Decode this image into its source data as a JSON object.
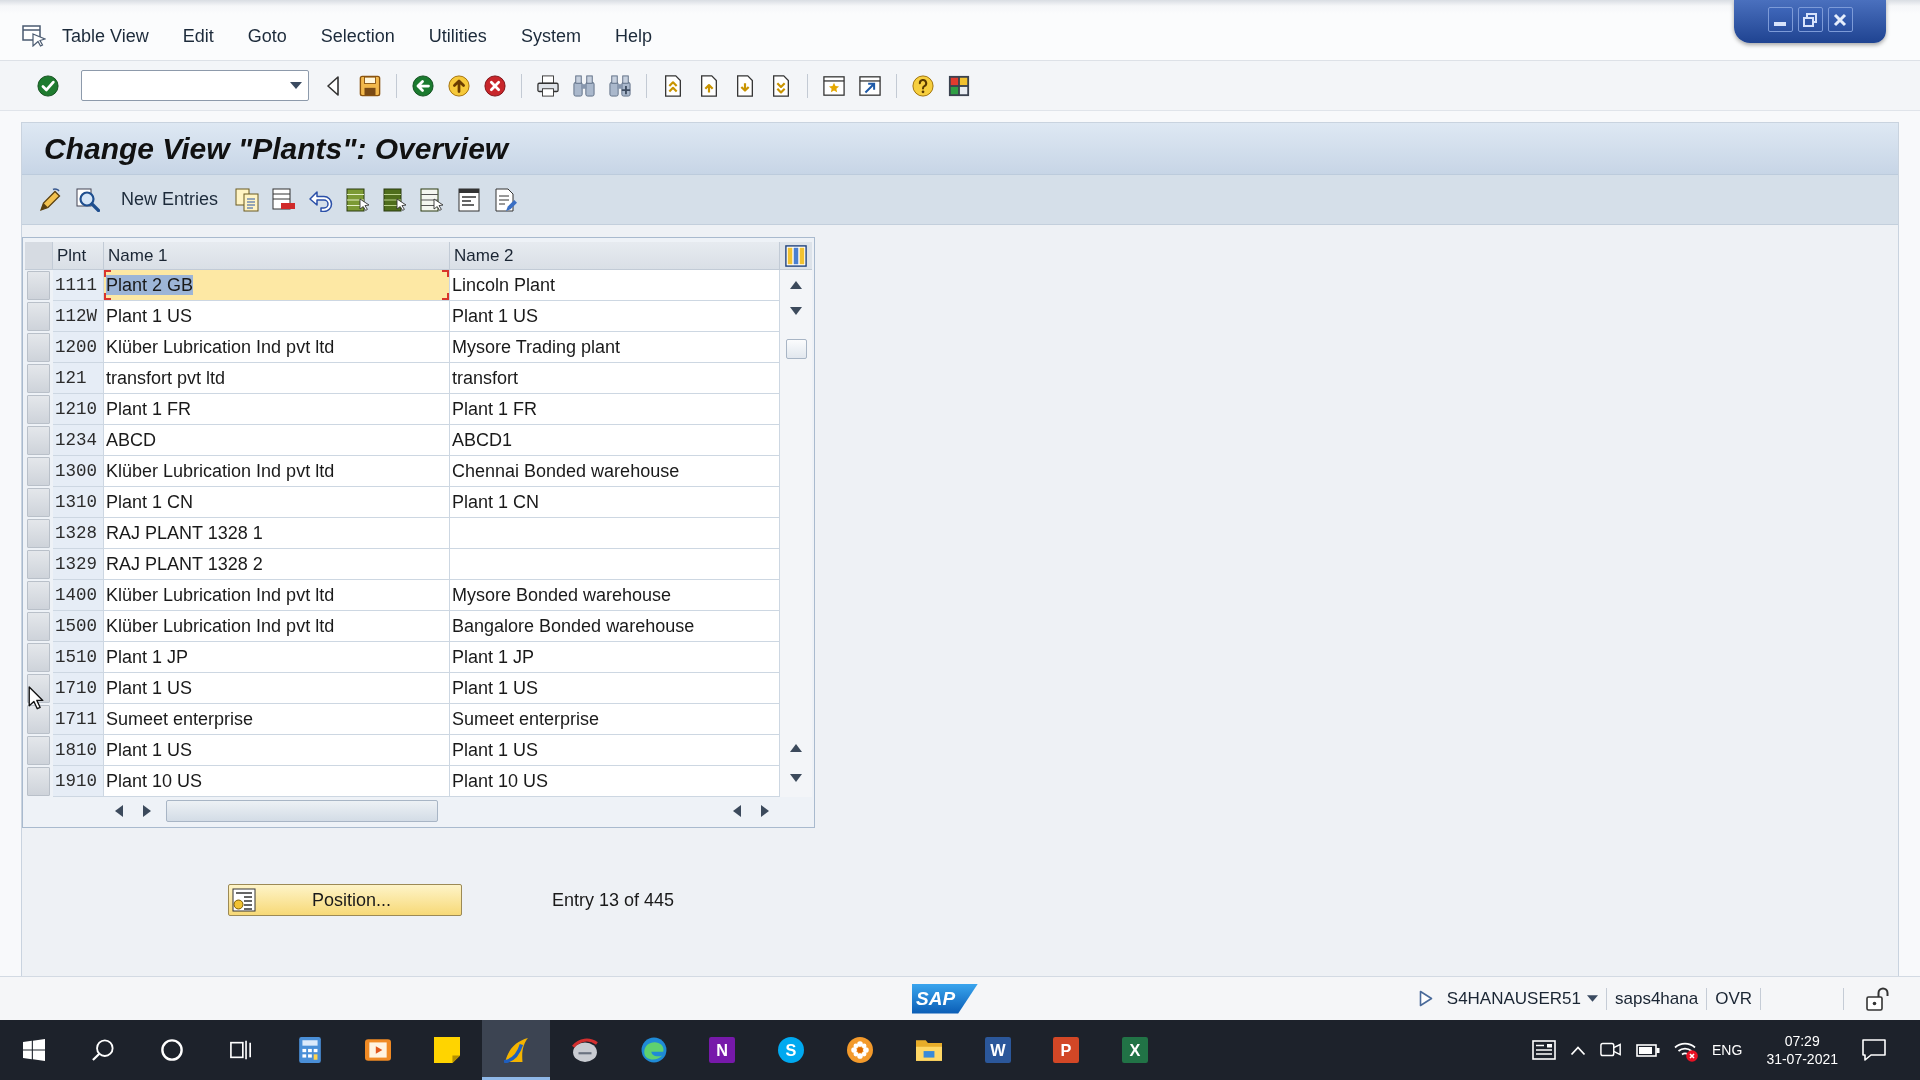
{
  "menu_bar": {
    "items": [
      "Table View",
      "Edit",
      "Goto",
      "Selection",
      "Utilities",
      "System",
      "Help"
    ]
  },
  "title": "Change View \"Plants\": Overview",
  "application_toolbar": {
    "new_entries_button": "New Entries"
  },
  "table": {
    "columns": [
      "Plnt",
      "Name 1",
      "Name 2"
    ],
    "rows": [
      {
        "plnt": "1111",
        "name_1": "Plant 2 GB",
        "name_2": "Lincoln Plant",
        "focused": true
      },
      {
        "plnt": "112W",
        "name_1": "Plant 1 US",
        "name_2": "Plant 1 US",
        "focused": false
      },
      {
        "plnt": "1200",
        "name_1": "Klüber Lubrication Ind pvt ltd",
        "name_2": "Mysore Trading plant",
        "focused": false
      },
      {
        "plnt": "121",
        "name_1": "transfort pvt ltd",
        "name_2": "transfort",
        "focused": false
      },
      {
        "plnt": "1210",
        "name_1": "Plant 1 FR",
        "name_2": "Plant 1 FR",
        "focused": false
      },
      {
        "plnt": "1234",
        "name_1": "ABCD",
        "name_2": "ABCD1",
        "focused": false
      },
      {
        "plnt": "1300",
        "name_1": "Klüber Lubrication Ind pvt ltd",
        "name_2": "Chennai Bonded warehouse",
        "focused": false
      },
      {
        "plnt": "1310",
        "name_1": "Plant 1 CN",
        "name_2": "Plant 1 CN",
        "focused": false
      },
      {
        "plnt": "1328",
        "name_1": "RAJ PLANT 1328 1",
        "focused": false
      },
      {
        "plnt": "1329",
        "name_1": "RAJ PLANT 1328 2",
        "focused": false
      },
      {
        "plnt": "1400",
        "name_1": "Klüber Lubrication Ind pvt ltd",
        "name_2": "Mysore Bonded warehouse",
        "focused": false
      },
      {
        "plnt": "1500",
        "name_1": "Klüber Lubrication Ind pvt ltd",
        "name_2": "Bangalore Bonded warehouse",
        "focused": false
      },
      {
        "plnt": "1510",
        "name_1": "Plant 1 JP",
        "name_2": "Plant 1 JP",
        "focused": false
      },
      {
        "plnt": "1710",
        "name_1": "Plant 1 US",
        "name_2": "Plant 1 US",
        "focused": false
      },
      {
        "plnt": "1711",
        "name_1": "Sumeet enterprise",
        "name_2": "Sumeet enterprise",
        "focused": false
      },
      {
        "plnt": "1810",
        "name_1": "Plant 1 US",
        "name_2": "Plant 1 US",
        "focused": false
      },
      {
        "plnt": "1910",
        "name_1": "Plant 10 US",
        "name_2": "Plant 10 US",
        "focused": false
      }
    ]
  },
  "position_button": "Position...",
  "entry_info": "Entry 13 of 445",
  "status_bar": {
    "logo": "SAP",
    "user": "S4HANAUSER51",
    "system": "saps4hana",
    "mode": "OVR"
  },
  "taskbar": {
    "apps": [
      {
        "kind": "calculator",
        "active": false
      },
      {
        "kind": "media_player",
        "active": false
      },
      {
        "kind": "sticky_notes",
        "active": false
      },
      {
        "kind": "sap_logon",
        "active": true
      },
      {
        "kind": "sap_gui",
        "active": false
      },
      {
        "kind": "edge",
        "active": false
      },
      {
        "kind": "onenote",
        "letter": "N",
        "active": false
      },
      {
        "kind": "skype",
        "letter": "S",
        "active": false
      },
      {
        "kind": "flower",
        "active": false
      },
      {
        "kind": "file_explorer",
        "active": false
      },
      {
        "kind": "word",
        "letter": "W",
        "active": false
      },
      {
        "kind": "powerpoint",
        "letter": "P",
        "active": false
      },
      {
        "kind": "excel",
        "letter": "X",
        "active": false
      }
    ],
    "language": "ENG",
    "time": "07:29",
    "date": "31-07-2021"
  }
}
